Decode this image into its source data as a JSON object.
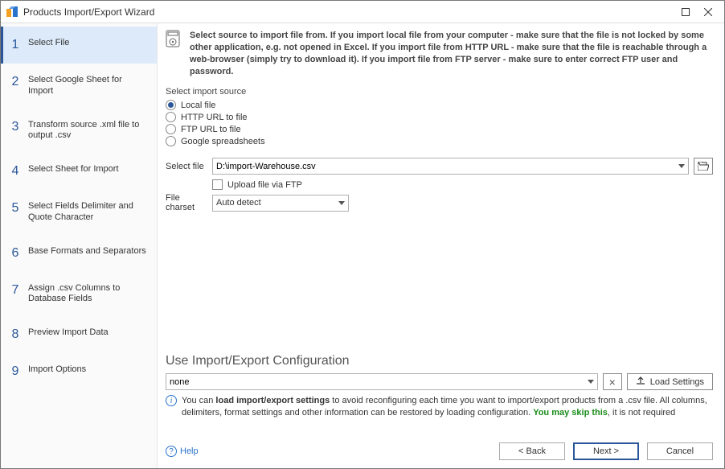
{
  "window": {
    "title": "Products Import/Export Wizard"
  },
  "steps": [
    {
      "num": "1",
      "label": "Select File"
    },
    {
      "num": "2",
      "label": "Select Google Sheet for Import"
    },
    {
      "num": "3",
      "label": "Transform source .xml file to output .csv"
    },
    {
      "num": "4",
      "label": "Select Sheet for Import"
    },
    {
      "num": "5",
      "label": "Select Fields Delimiter and Quote Character"
    },
    {
      "num": "6",
      "label": "Base Formats and Separators"
    },
    {
      "num": "7",
      "label": "Assign .csv Columns to Database Fields"
    },
    {
      "num": "8",
      "label": "Preview Import Data"
    },
    {
      "num": "9",
      "label": "Import Options"
    }
  ],
  "intro": "Select source to import file from. If you import local file from your computer - make sure that the file is not locked by some other application, e.g. not opened in Excel. If you import file from HTTP URL - make sure that the file is reachable through a web-browser (simply try to download it). If you import file from FTP server - make sure to enter correct FTP user and password.",
  "source": {
    "label": "Select import source",
    "options": {
      "local": "Local file",
      "http": "HTTP URL to file",
      "ftp": "FTP URL to file",
      "google": "Google spreadsheets"
    }
  },
  "file": {
    "label": "Select file",
    "value": "D:\\import-Warehouse.csv",
    "upload_label": "Upload file via FTP"
  },
  "charset": {
    "label": "File charset",
    "value": "Auto detect"
  },
  "config": {
    "title": "Use Import/Export Configuration",
    "value": "none",
    "load_label": "Load Settings",
    "info_prefix": "You can ",
    "info_bold": "load import/export settings",
    "info_mid": " to avoid reconfiguring each time you want to import/export products from a .csv file. All columns, delimiters, format settings and other information can be restored by loading configuration. ",
    "info_skip": "You may skip this",
    "info_tail": ", it is not required"
  },
  "help": "Help",
  "buttons": {
    "back": "< Back",
    "next": "Next >",
    "cancel": "Cancel"
  }
}
